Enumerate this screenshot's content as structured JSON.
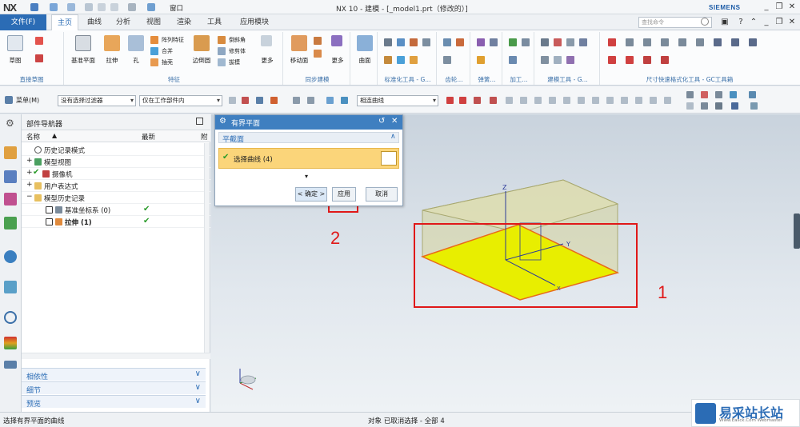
{
  "window": {
    "app_logo": "NX",
    "title": "NX 10 - 建模 - [_model1.prt（修改的）]",
    "brand": "SIEMENS",
    "window_menu": "窗口"
  },
  "tabs": {
    "file": "文件(F)",
    "items": [
      "主页",
      "曲线",
      "分析",
      "视图",
      "渲染",
      "工具",
      "应用模块"
    ],
    "active": "主页",
    "search_placeholder": "查找命令"
  },
  "ribbon": {
    "groups": [
      {
        "label": "直接草图",
        "buttons": [
          "草图"
        ]
      },
      {
        "label": "特征",
        "buttons": [
          "基准平面",
          "拉伸",
          "孔",
          "阵列特征",
          "合并",
          "抽壳",
          "边倒圆",
          "倒斜角",
          "修剪体",
          "拔模",
          "更多"
        ]
      },
      {
        "label": "同步建模",
        "buttons": [
          "移动面",
          "更多"
        ]
      },
      {
        "label": "",
        "buttons": [
          "曲面"
        ]
      },
      {
        "label": "标准化工具 - G...",
        "buttons": []
      },
      {
        "label": "齿轮...",
        "buttons": []
      },
      {
        "label": "弹簧...",
        "buttons": []
      },
      {
        "label": "加工...",
        "buttons": []
      },
      {
        "label": "建模工具 - G...",
        "buttons": []
      },
      {
        "label": "尺寸快速格式化工具 - GC工具箱",
        "buttons": []
      }
    ]
  },
  "toolbar2": {
    "menu": "菜单(M)",
    "filter": "没有选择过滤器",
    "scope": "仅在工作部件内",
    "curve_rule": "相连曲线"
  },
  "navigator": {
    "title": "部件导航器",
    "columns": [
      "名称",
      "最新",
      "附"
    ],
    "rows": [
      {
        "label": "历史记录模式",
        "check": ""
      },
      {
        "label": "模型视图",
        "check": ""
      },
      {
        "label": "摄像机",
        "check": ""
      },
      {
        "label": "用户表达式",
        "check": ""
      },
      {
        "label": "模型历史记录",
        "check": ""
      },
      {
        "label": "基准坐标系 (0)",
        "check": "✔"
      },
      {
        "label": "拉伸 (1)",
        "check": "✔"
      }
    ],
    "panels": [
      "相依性",
      "细节",
      "预览"
    ]
  },
  "dialog": {
    "title": "有界平面",
    "section": "平截面",
    "select_label": "选择曲线 (4)",
    "ok": "< 确定 >",
    "apply": "应用",
    "cancel": "取消"
  },
  "annotations": {
    "label1": "1",
    "label2": "2"
  },
  "status": {
    "left": "选择有界平面的曲线",
    "middle": "对象 已取消选择 - 全部 4"
  },
  "watermark": {
    "text": "易采站长站",
    "sub": "Www.Easck.Com Webmaster"
  },
  "colors": {
    "accent": "#2b6cb5",
    "highlight": "#e6f000",
    "annotation": "#e01818"
  }
}
